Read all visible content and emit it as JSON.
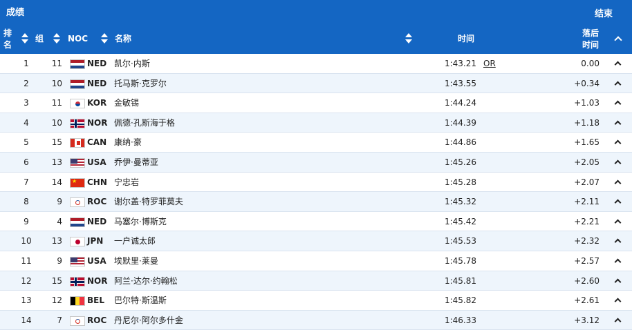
{
  "header": {
    "title": "成绩",
    "status": "结束",
    "columns": {
      "rank": "排名",
      "group": "组",
      "noc": "NOC",
      "name": "名称",
      "time": "时间",
      "gap": "落后\n时间"
    }
  },
  "rows": [
    {
      "rank": "1",
      "group": "11",
      "flag": "NED",
      "noc": "NED",
      "name": "凯尔·内斯",
      "time": "1:43.21",
      "record": "OR",
      "gap": "0.00"
    },
    {
      "rank": "2",
      "group": "10",
      "flag": "NED",
      "noc": "NED",
      "name": "托马斯·克罗尔",
      "time": "1:43.55",
      "record": "",
      "gap": "+0.34"
    },
    {
      "rank": "3",
      "group": "11",
      "flag": "KOR",
      "noc": "KOR",
      "name": "金敏锡",
      "time": "1:44.24",
      "record": "",
      "gap": "+1.03"
    },
    {
      "rank": "4",
      "group": "10",
      "flag": "NOR",
      "noc": "NOR",
      "name": "佩德·孔斯海于格",
      "time": "1:44.39",
      "record": "",
      "gap": "+1.18"
    },
    {
      "rank": "5",
      "group": "15",
      "flag": "CAN",
      "noc": "CAN",
      "name": "康纳·豪",
      "time": "1:44.86",
      "record": "",
      "gap": "+1.65"
    },
    {
      "rank": "6",
      "group": "13",
      "flag": "USA",
      "noc": "USA",
      "name": "乔伊·曼蒂亚",
      "time": "1:45.26",
      "record": "",
      "gap": "+2.05"
    },
    {
      "rank": "7",
      "group": "14",
      "flag": "CHN",
      "noc": "CHN",
      "name": "宁忠岩",
      "time": "1:45.28",
      "record": "",
      "gap": "+2.07"
    },
    {
      "rank": "8",
      "group": "9",
      "flag": "ROC",
      "noc": "ROC",
      "name": "谢尔盖·特罗菲莫夫",
      "time": "1:45.32",
      "record": "",
      "gap": "+2.11"
    },
    {
      "rank": "9",
      "group": "4",
      "flag": "NED",
      "noc": "NED",
      "name": "马塞尔·博斯克",
      "time": "1:45.42",
      "record": "",
      "gap": "+2.21"
    },
    {
      "rank": "10",
      "group": "13",
      "flag": "JPN",
      "noc": "JPN",
      "name": "一户诚太郎",
      "time": "1:45.53",
      "record": "",
      "gap": "+2.32"
    },
    {
      "rank": "11",
      "group": "9",
      "flag": "USA",
      "noc": "USA",
      "name": "埃默里·莱曼",
      "time": "1:45.78",
      "record": "",
      "gap": "+2.57"
    },
    {
      "rank": "12",
      "group": "15",
      "flag": "NOR",
      "noc": "NOR",
      "name": "阿兰·达尔·约翰松",
      "time": "1:45.81",
      "record": "",
      "gap": "+2.60"
    },
    {
      "rank": "13",
      "group": "12",
      "flag": "BEL",
      "noc": "BEL",
      "name": "巴尔特·斯温斯",
      "time": "1:45.82",
      "record": "",
      "gap": "+2.61"
    },
    {
      "rank": "14",
      "group": "7",
      "flag": "ROC",
      "noc": "ROC",
      "name": "丹尼尔·阿尔多什金",
      "time": "1:46.33",
      "record": "",
      "gap": "+3.12"
    }
  ]
}
